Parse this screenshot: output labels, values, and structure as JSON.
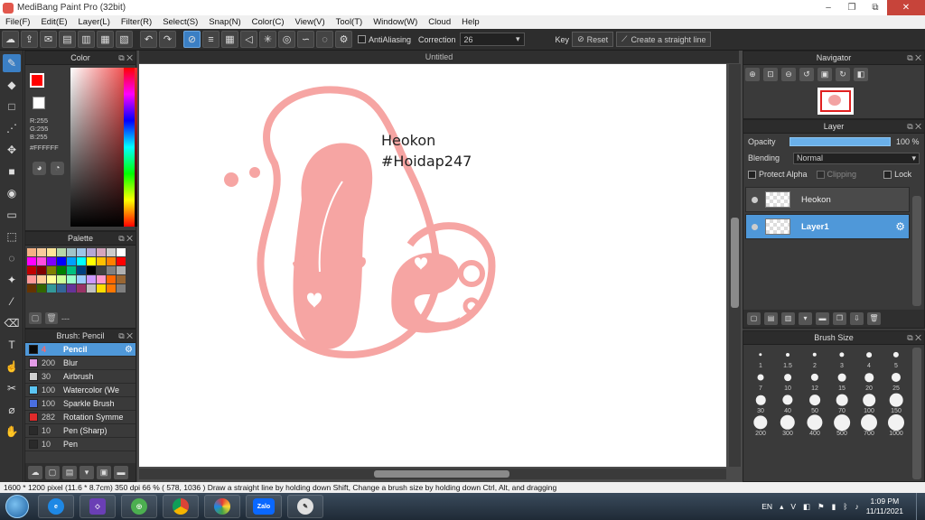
{
  "window": {
    "title": "MediBang Paint Pro (32bit)",
    "buttons": [
      "–",
      "❐",
      "⧉",
      "✕"
    ]
  },
  "menu": [
    "File(F)",
    "Edit(E)",
    "Layer(L)",
    "Filter(R)",
    "Select(S)",
    "Snap(N)",
    "Color(C)",
    "View(V)",
    "Tool(T)",
    "Window(W)",
    "Cloud",
    "Help"
  ],
  "toolbar": {
    "antialiasing_label": "AntiAliasing",
    "correction_label": "Correction",
    "correction_value": "26",
    "key_label": "Key",
    "reset_label": "Reset",
    "straight_line_label": "Create a straight line"
  },
  "color_panel": {
    "title": "Color",
    "r": "R:255",
    "g": "G:255",
    "b": "B:255",
    "hex": "#FFFFFF",
    "main_color": "#ff0000"
  },
  "palette_panel": {
    "title": "Palette",
    "footer_text": "---",
    "colors": [
      "#f4b084",
      "#f9cb9c",
      "#ffe599",
      "#b6d7a8",
      "#a2c4c9",
      "#9fc5e8",
      "#b4a7d6",
      "#d5a6bd",
      "#cccccc",
      "#ffffff",
      "#ff00ff",
      "#ff4de0",
      "#7f00ff",
      "#0000ff",
      "#00a0ff",
      "#00ffff",
      "#ffff00",
      "#ffc000",
      "#ff8000",
      "#ff0000",
      "#c00000",
      "#800000",
      "#808000",
      "#008000",
      "#00c080",
      "#004080",
      "#000000",
      "#404040",
      "#808080",
      "#b0b0b0",
      "#ff9999",
      "#ffcc99",
      "#ffff99",
      "#ccff99",
      "#99ffcc",
      "#99ccff",
      "#cc99ff",
      "#ff99cc",
      "#ff6600",
      "#996633",
      "#663300",
      "#336600",
      "#339999",
      "#336699",
      "#663399",
      "#993366",
      "#c0c0c0",
      "#ffdd00",
      "#ff7700",
      "#7f7f7f"
    ]
  },
  "brush_panel": {
    "title": "Brush: Pencil",
    "items": [
      {
        "size": "4",
        "name": "Pencil",
        "color": "#0a0a0a"
      },
      {
        "size": "200",
        "name": "Blur",
        "color": "#e29be6"
      },
      {
        "size": "30",
        "name": "Airbrush",
        "color": "#d0d0d0"
      },
      {
        "size": "100",
        "name": "Watercolor (We",
        "color": "#5bc5f2"
      },
      {
        "size": "100",
        "name": "Sparkle Brush",
        "color": "#4a6fe0"
      },
      {
        "size": "282",
        "name": "Rotation Symme",
        "color": "#e02b2b"
      },
      {
        "size": "10",
        "name": "Pen (Sharp)",
        "color": "#2a2a2a"
      },
      {
        "size": "10",
        "name": "Pen",
        "color": "#2a2a2a"
      }
    ]
  },
  "canvas": {
    "doc_title": "Untitled",
    "signature_line1": "Heokon",
    "signature_line2": "#Hoidap247",
    "art_color": "#f6a5a3"
  },
  "navigator": {
    "title": "Navigator"
  },
  "layer_panel": {
    "title": "Layer",
    "opacity_label": "Opacity",
    "opacity_value": "100 %",
    "opacity_percent": 100,
    "blending_label": "Blending",
    "blending_value": "Normal",
    "protect_alpha_label": "Protect Alpha",
    "clipping_label": "Clipping",
    "lock_label": "Lock",
    "layers": [
      {
        "name": "Heokon",
        "selected": false
      },
      {
        "name": "Layer1",
        "selected": true
      }
    ]
  },
  "brush_size_panel": {
    "title": "Brush Size",
    "sizes": [
      "1",
      "1.5",
      "2",
      "3",
      "4",
      "5",
      "7",
      "10",
      "12",
      "15",
      "20",
      "25",
      "30",
      "40",
      "50",
      "70",
      "100",
      "150",
      "200",
      "300",
      "400",
      "500",
      "700",
      "1000"
    ]
  },
  "status": {
    "text": "1600 * 1200 pixel  (11.6 * 8.7cm)  350 dpi  66 %  ( 578, 1036 )  Draw a straight line by holding down Shift, Change a brush size by holding down Ctrl, Alt, and dragging"
  },
  "taskbar": {
    "lang": "EN",
    "time": "1:09 PM",
    "date": "11/11/2021",
    "zalo_label": "Zalo"
  }
}
